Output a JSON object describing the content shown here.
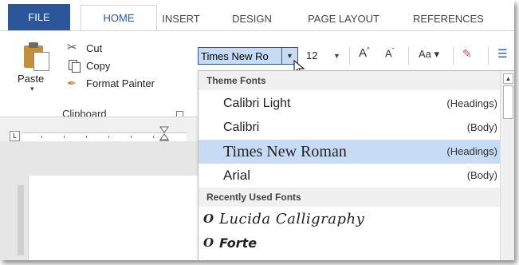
{
  "tabs": {
    "file": "FILE",
    "home": "HOME",
    "insert": "INSERT",
    "design": "DESIGN",
    "page_layout": "PAGE LAYOUT",
    "references": "REFERENCES"
  },
  "clipboard": {
    "paste_label": "Paste",
    "cut_label": "Cut",
    "copy_label": "Copy",
    "format_painter_label": "Format Painter",
    "group_label": "Clipboard"
  },
  "font": {
    "current_font": "Times New Ro",
    "current_size": "12",
    "grow_icon": "A",
    "shrink_icon": "A",
    "change_case_label": "Aa"
  },
  "font_menu": {
    "theme_header": "Theme Fonts",
    "theme_fonts": [
      {
        "name": "Calibri Light",
        "tag": "(Headings)"
      },
      {
        "name": "Calibri",
        "tag": "(Body)"
      },
      {
        "name": "Times New Roman",
        "tag": "(Headings)"
      },
      {
        "name": "Arial",
        "tag": "(Body)"
      }
    ],
    "recent_header": "Recently Used Fonts",
    "recent_fonts": [
      "Lucida Calligraphy",
      "Forte"
    ],
    "selected_font": "Times New Roman"
  },
  "colors": {
    "accent": "#2b579a",
    "selection": "#c7dcf4"
  }
}
